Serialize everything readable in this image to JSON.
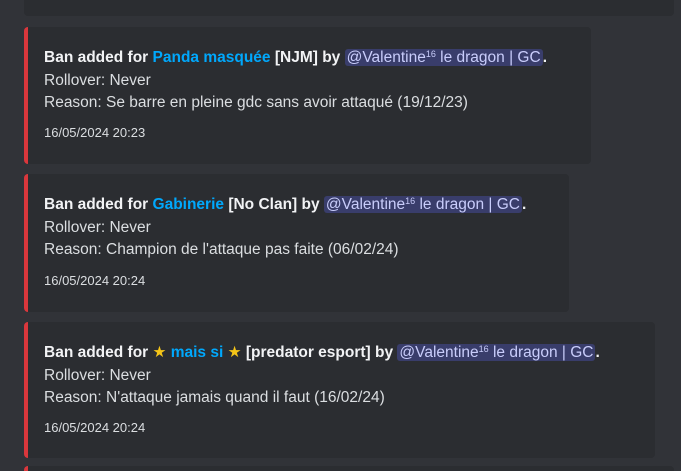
{
  "embeds": [
    {
      "prefix": "Ban added for ",
      "player": "Panda masquée",
      "clan": " [NJM] by ",
      "mention_name": "@Valentine",
      "mention_sup": "16",
      "mention_rest": " le dragon | GC",
      "end": ".",
      "rollover": "Rollover: Never",
      "reason": "Reason: Se barre en pleine gdc sans avoir attaqué (19/12/23)",
      "timestamp": "16/05/2024 20:23"
    },
    {
      "prefix": "Ban added for ",
      "player": "Gabinerie",
      "clan": " [No Clan] by ",
      "mention_name": "@Valentine",
      "mention_sup": "16",
      "mention_rest": " le dragon | GC",
      "end": ".",
      "rollover": "Rollover: Never",
      "reason": "Reason: Champion de l'attaque pas faite (06/02/24)",
      "timestamp": "16/05/2024 20:24"
    },
    {
      "prefix": "Ban added for ",
      "star_left": "★",
      "player": " mais si ",
      "star_right": "★",
      "clan": " [predator esport] by ",
      "mention_name": "@Valentine",
      "mention_sup": "16",
      "mention_rest": " le dragon | GC",
      "end": ".",
      "rollover": "Rollover: Never",
      "reason": "Reason: N'attaque jamais quand il faut (16/02/24)",
      "timestamp": "16/05/2024 20:24"
    }
  ],
  "colors": {
    "accent_bar": "#da373c",
    "player_link": "#00a8fc",
    "mention_bg": "#3c4270",
    "embed_bg": "#2b2d31",
    "page_bg": "#313338"
  }
}
